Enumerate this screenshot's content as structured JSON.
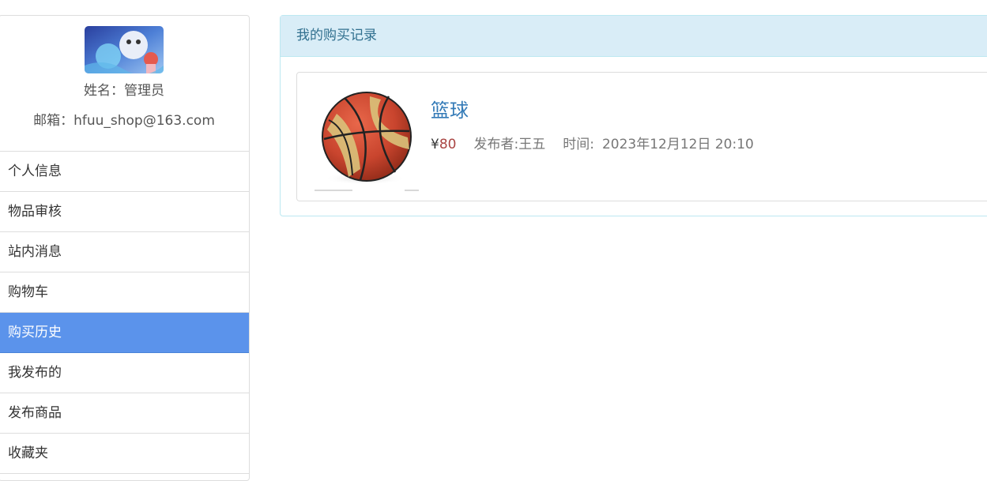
{
  "sidebar": {
    "profile": {
      "name_label": "姓名：",
      "name": "管理员",
      "email_label": "邮箱：",
      "email": "hfuu_shop@163.com"
    },
    "items": [
      {
        "label": "个人信息",
        "active": false
      },
      {
        "label": "物品审核",
        "active": false
      },
      {
        "label": "站内消息",
        "active": false
      },
      {
        "label": "购物车",
        "active": false
      },
      {
        "label": "购买历史",
        "active": true
      },
      {
        "label": "我发布的",
        "active": false
      },
      {
        "label": "发布商品",
        "active": false
      },
      {
        "label": "收藏夹",
        "active": false
      }
    ]
  },
  "main": {
    "panel_title": "我的购买记录",
    "records": [
      {
        "title": "篮球",
        "currency": "¥",
        "price": "80",
        "publisher": "发布者:王五",
        "time_label": "时间:",
        "time": "2023年12月12日 20:10"
      }
    ]
  },
  "colors": {
    "active_nav": "#5b93eb",
    "panel_heading_bg": "#d9edf7",
    "panel_heading_text": "#31708f",
    "link": "#337ab7",
    "price": "#a94442"
  }
}
